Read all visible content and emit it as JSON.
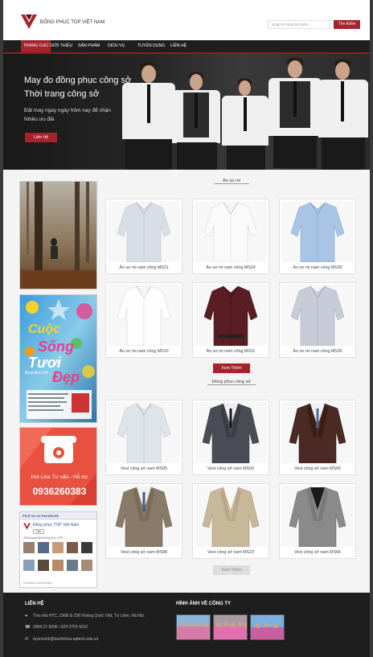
{
  "header": {
    "brand": "ĐỒNG PHỤC TOP VIỆT NAM",
    "search_placeholder": "Nhập từ khóa tìm kiếm...",
    "search_button": "Tìm Kiếm"
  },
  "nav": {
    "items": [
      "TRANG CHỦ",
      "GIỚI THIỆU",
      "SẢN PHẨM",
      "DỊCH VỤ",
      "TUYỂN DỤNG",
      "LIÊN HỆ"
    ]
  },
  "hero": {
    "title": "May đo đồng phục công sở",
    "subtitle": "Thời trang công sở",
    "text1": "Đặt may ngay ngày hôm nay để nhận",
    "text2": "Nhiều ưu đãi",
    "button": "Liên hệ"
  },
  "sidebar": {
    "banner_line1": "Cuộc",
    "banner_line2": "Sống",
    "banner_line3": "Tươi",
    "banner_line4": "Đẹp",
    "banner_small": "Beautiful Life",
    "hotline_label": "Hot Line Tư vấn - Hỗ trợ",
    "hotline_number": "0936260383",
    "fb_header": "Find us on Facebook",
    "fb_page": "Đồng phục TOP Việt Nam",
    "fb_like": "Like",
    "fb_count": "226 people like Đồng phục TOP",
    "fb_plugin": "Facebook social plugin"
  },
  "section1": {
    "title": "Áo sơ mi",
    "products": [
      "Áo sơ mi nam công MS21",
      "Áo sơ mi nam công MS24",
      "Áo sơ mi nam công MS30",
      "Áo sơ mi nam công MS10",
      "Áo sơ mi nam công MS11",
      "Áo sơ mi nam công MS36"
    ],
    "more": "Xem Thêm"
  },
  "section2": {
    "title": "Đồng phục công sở",
    "products": [
      "Vest công sở nam MS05",
      "Vest công sở nam MS09",
      "Vest công sở nam MS66",
      "Vest công sở nam MS88",
      "Vest công sở nam MS23",
      "Vest công sở nam MS66"
    ],
    "more": "Xem Thêm"
  },
  "footer": {
    "contact_title": "LIÊN HỆ",
    "address": "Tòa nhà HTC, 236B & 238 Hoàng Quốc Việt, Từ Liêm, Hà Nội.",
    "phone": "0968.27.6096 / 024 3755 4010",
    "email": "tuyensinh@bachkhoa-aptech.edu.vn",
    "gallery_title": "HÌNH ẢNH VỀ CÔNG TY"
  },
  "colors": {
    "accent": "#a4242b",
    "nav_bg": "#1f1f1f",
    "footer_bg": "#1e1e1e"
  }
}
